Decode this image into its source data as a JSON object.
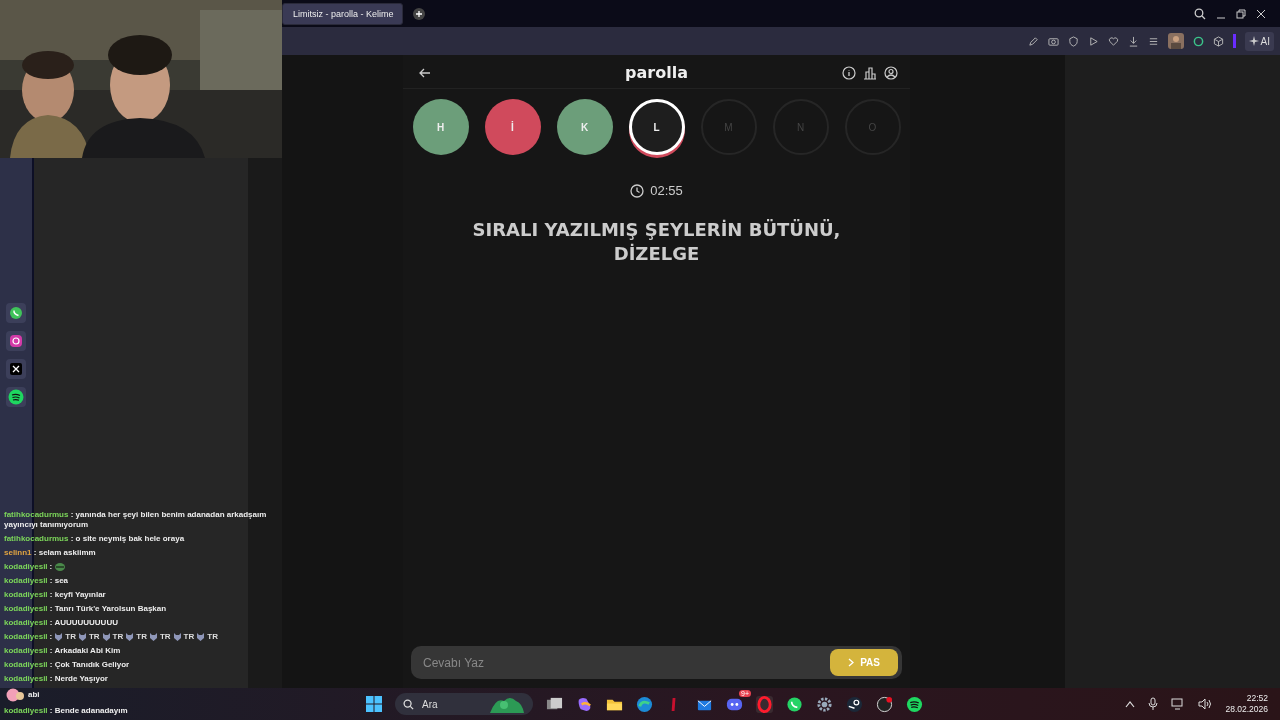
{
  "browser": {
    "tabs": [
      {
        "label": "Limitsiz - parolla - Kelime",
        "selected": true
      }
    ],
    "ai_button": "AI"
  },
  "game": {
    "title": "parolla",
    "letters": [
      {
        "letter": "H",
        "kind": "correct"
      },
      {
        "letter": "İ",
        "kind": "wrong"
      },
      {
        "letter": "K",
        "kind": "correct"
      },
      {
        "letter": "L",
        "kind": "current"
      },
      {
        "letter": "M",
        "kind": "pending"
      },
      {
        "letter": "N",
        "kind": "pending"
      },
      {
        "letter": "O",
        "kind": "pending"
      }
    ],
    "timer": "02:55",
    "question_lines": [
      "SIRALI YAZILMIŞ ŞEYLERİN BÜTÜNÜ,",
      "DİZELGE"
    ],
    "answer": {
      "placeholder": "Cevabı Yaz"
    },
    "pass_button": "PAS"
  },
  "chat": [
    {
      "kind": "text",
      "user": "fatihkocadurmus",
      "color": "#7cd65a",
      "text": ": yanında her şeyi bilen benim adanadan arkadşaım yayıncıyı tanımıyorum"
    },
    {
      "kind": "text",
      "user": "fatihkocadurmus",
      "color": "#7cd65a",
      "text": ": o site neymiş bak hele oraya"
    },
    {
      "kind": "text",
      "user": "selinn1",
      "color": "#e0a341",
      "text": ": selam askiimm"
    },
    {
      "kind": "emote",
      "user": "kodadiyesil",
      "color": "#7cd65a",
      "text": ":"
    },
    {
      "kind": "text",
      "user": "kodadiyesil",
      "color": "#7cd65a",
      "text": ": sea"
    },
    {
      "kind": "text",
      "user": "kodadiyesil",
      "color": "#7cd65a",
      "text": ": keyfi Yayınlar"
    },
    {
      "kind": "text",
      "user": "kodadiyesil",
      "color": "#7cd65a",
      "text": ": Tanrı Türk'e Yarolsun Başkan"
    },
    {
      "kind": "text",
      "user": "kodadiyesil",
      "color": "#7cd65a",
      "text": ": AUUUUUUUUUU"
    },
    {
      "kind": "emotes",
      "user": "kodadiyesil",
      "color": "#7cd65a",
      "text": ":",
      "emotes": [
        "TR",
        "TR",
        "TR",
        "TR",
        "TR",
        "TR",
        "TR"
      ]
    },
    {
      "kind": "text",
      "user": "kodadiyesil",
      "color": "#7cd65a",
      "text": ": Arkadaki Abi Kim"
    },
    {
      "kind": "text",
      "user": "kodadiyesil",
      "color": "#7cd65a",
      "text": ": Çok Tanıdık Geliyor"
    },
    {
      "kind": "text",
      "user": "kodadiyesil",
      "color": "#7cd65a",
      "text": ": Nerde Yaşıyor"
    },
    {
      "kind": "covered",
      "text": "abi"
    },
    {
      "kind": "text",
      "user": "kodadiyesil",
      "color": "#7cd65a",
      "text": ": Bende adanadayım"
    }
  ],
  "taskbar": {
    "search": {
      "placeholder": "Ara"
    },
    "discord_badge": "9+",
    "time": "22:52",
    "date": "28.02.2026"
  }
}
